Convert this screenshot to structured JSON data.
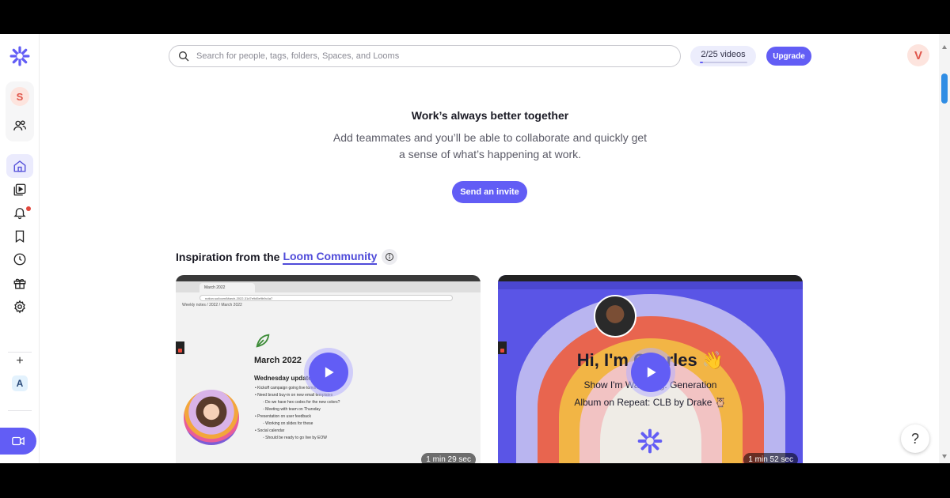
{
  "search": {
    "placeholder": "Search for people, tags, folders, Spaces, and Looms"
  },
  "header": {
    "video_count_label": "2/25 videos",
    "video_count_used": 2,
    "video_count_total": 25,
    "upgrade_label": "Upgrade",
    "user_initial": "V"
  },
  "sidebar": {
    "workspace_initial": "S",
    "space_initial": "A",
    "add_label": "+"
  },
  "hero": {
    "title": "Work’s always better together",
    "description": "Add teammates and you’ll be able to collaborate and quickly get a sense of what’s happening at work.",
    "invite_label": "Send an invite"
  },
  "inspiration": {
    "prefix": "Inspiration from the",
    "link": "Loom Community"
  },
  "cards": [
    {
      "duration": "1 min 29 sec",
      "tab_label": "March 2022",
      "url": "notion.so/loom/March-2022-31d7e9d5e9b9c4a7",
      "breadcrumb": "Weekly notes / 2022 / March 2022",
      "doc_title": "March 2022",
      "doc_subtitle": "Wednesday update",
      "doc_items": [
        {
          "text": "Kickoff campaign going live tomorrow",
          "indent": false
        },
        {
          "text": "Need brand buy-in on new email templates",
          "indent": false
        },
        {
          "text": "Do we have hex codes for the new colors?",
          "indent": true
        },
        {
          "text": "Meeting with team on Thursday",
          "indent": true
        },
        {
          "text": "Presentation on user feedback",
          "indent": false
        },
        {
          "text": "Working on slides for these",
          "indent": true
        },
        {
          "text": "Social calendar",
          "indent": false
        },
        {
          "text": "Should be ready to go live by EOW",
          "indent": true
        }
      ]
    },
    {
      "duration": "1 min 52 sec",
      "title": "Hi, I'm Charles 👋",
      "line1": "Show I'm Watching: Generation",
      "line2": "Album on Repeat: CLB by Drake 🦉"
    }
  ],
  "colors": {
    "accent": "#625df5",
    "link": "#4f4bd9"
  },
  "help_label": "?"
}
